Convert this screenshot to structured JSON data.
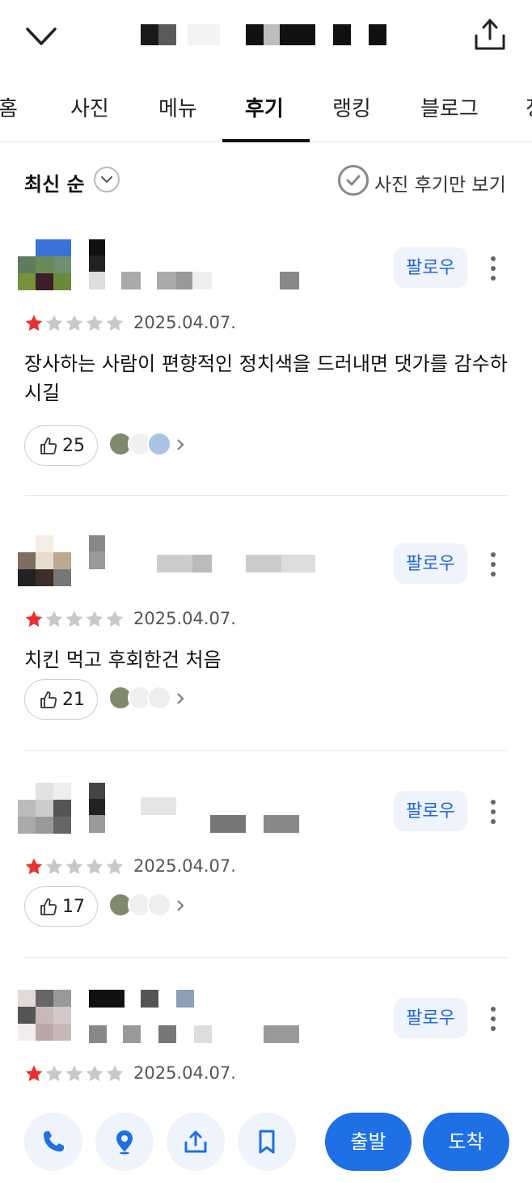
{
  "header": {
    "back_icon": "chevron-down-icon",
    "share_icon": "share-icon",
    "title_blurred": true
  },
  "tabs": [
    {
      "label": "홈"
    },
    {
      "label": "사진"
    },
    {
      "label": "메뉴"
    },
    {
      "label": "후기",
      "active": true
    },
    {
      "label": "랭킹"
    },
    {
      "label": "블로그"
    },
    {
      "label": "정"
    }
  ],
  "filter": {
    "sort_label": "최신 순",
    "photo_only_label": "사진 후기만 보기"
  },
  "reviews": [
    {
      "follow_label": "팔로우",
      "rating": 1,
      "date": "2025.04.07.",
      "text": "장사하는 사람이 편향적인 정치색을 드러내면 댓가를 감수하시길",
      "likes": "25"
    },
    {
      "follow_label": "팔로우",
      "rating": 1,
      "date": "2025.04.07.",
      "text": "치킨 먹고 후회한건 처음",
      "likes": "21"
    },
    {
      "follow_label": "팔로우",
      "rating": 1,
      "date": "2025.04.07.",
      "text": "",
      "likes": "17"
    },
    {
      "follow_label": "팔로우",
      "rating": 1,
      "date": "2025.04.07.",
      "text": "",
      "likes": ""
    }
  ],
  "bottom": {
    "depart_label": "출발",
    "arrive_label": "도착"
  },
  "colors": {
    "accent": "#1f6fe5",
    "follow_bg": "#eef3fc",
    "follow_text": "#2468d8",
    "star_on": "#e8322f",
    "star_off": "#c8c8c8"
  }
}
